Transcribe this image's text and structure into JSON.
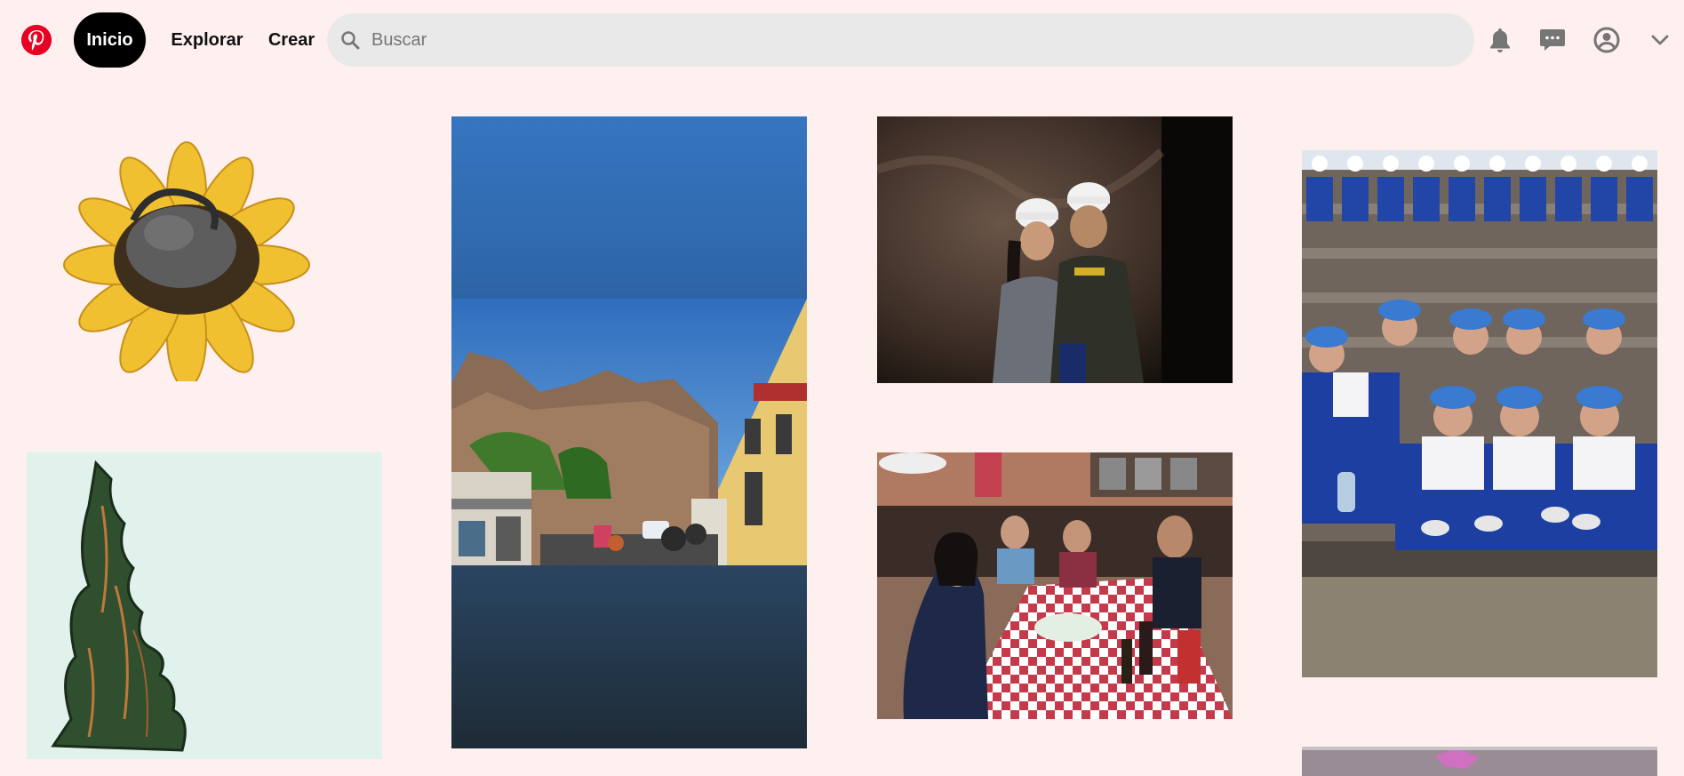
{
  "header": {
    "logo_icon": "pinterest-logo-icon",
    "nav": {
      "home_label": "Inicio",
      "explore_label": "Explorar",
      "create_label": "Crear"
    },
    "search": {
      "placeholder": "Buscar",
      "value": ""
    },
    "icons": [
      "bell-icon",
      "chat-icon",
      "user-icon",
      "chevron-down-icon"
    ]
  },
  "pins": [
    {
      "name": "pin-sunflower-sculpture",
      "content": "sunflower sculpture"
    },
    {
      "name": "pin-flame-sculpture",
      "content": "flame sculpture"
    },
    {
      "name": "pin-mountain-town-street",
      "content": "mountain town street"
    },
    {
      "name": "pin-cave-couple",
      "content": "couple in hard hats in cave"
    },
    {
      "name": "pin-restaurant-group",
      "content": "group at restaurant table"
    },
    {
      "name": "pin-schoolchildren-steps",
      "content": "schoolchildren on steps"
    },
    {
      "name": "pin-partial-bottom",
      "content": "partial pin"
    }
  ],
  "colors": {
    "background": "#fff0f0",
    "brand": "#e60023",
    "pill_active": "#000000",
    "search_bg": "#e9e9e9"
  }
}
